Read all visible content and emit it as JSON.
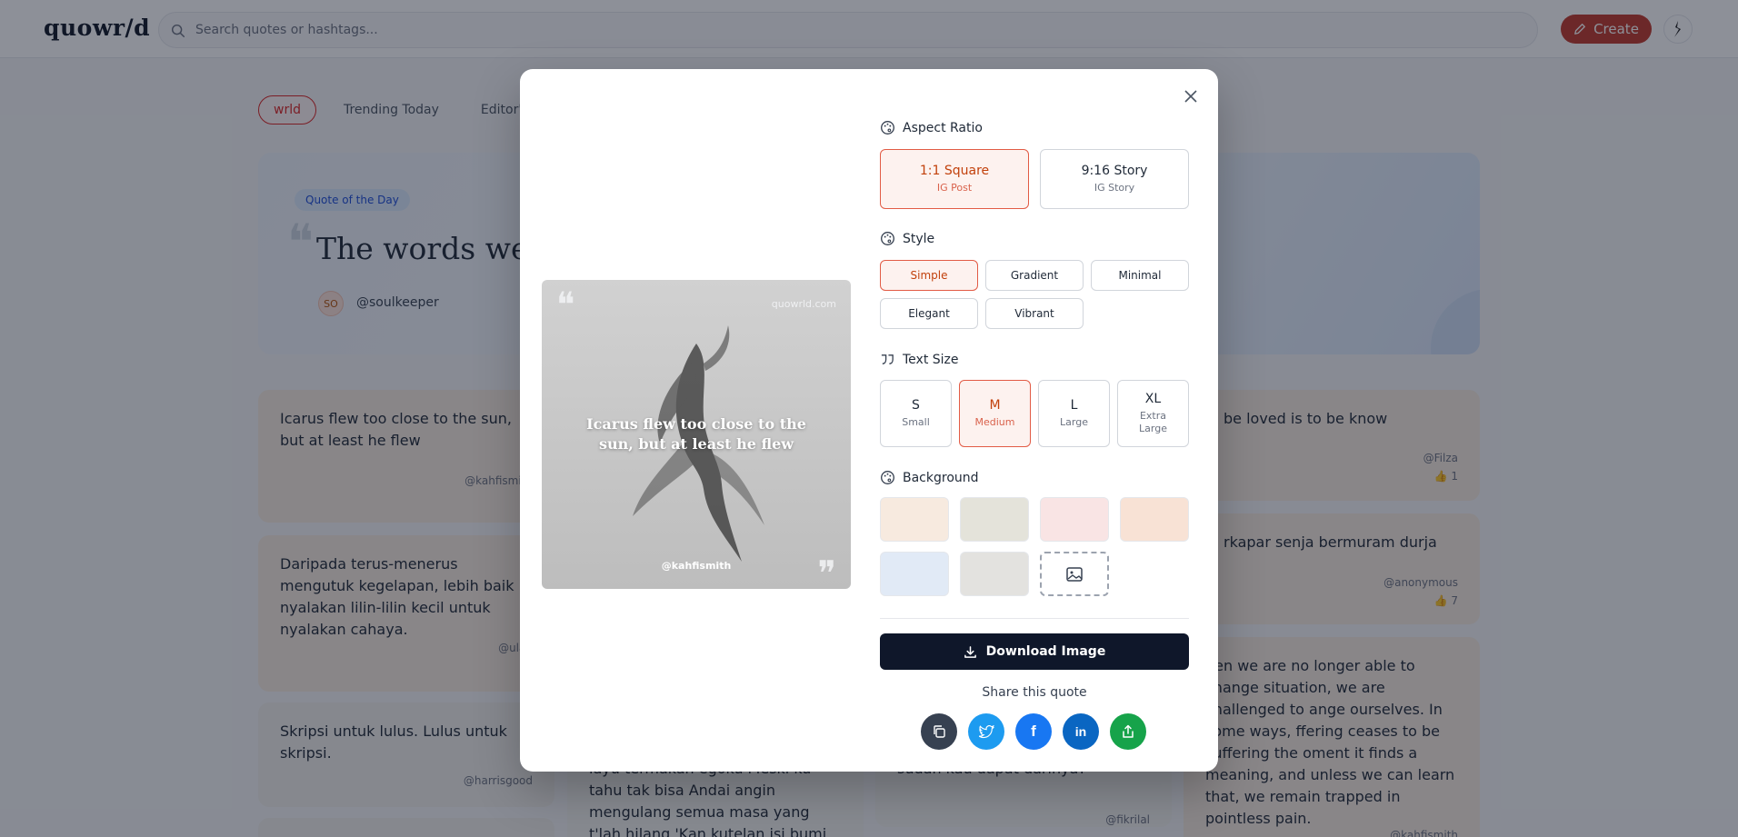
{
  "header": {
    "logo": "quowr/d",
    "search_placeholder": "Search quotes or hashtags...",
    "create_label": "Create"
  },
  "tabs": [
    {
      "label": "wrld",
      "active": true
    },
    {
      "label": "Trending Today",
      "active": false
    },
    {
      "label": "Editor's Picks",
      "active": false
    }
  ],
  "quote_of_day": {
    "badge": "Quote of the Day",
    "text": "The words we do",
    "avatar_initials": "SO",
    "user": "@soulkeeper"
  },
  "cards": [
    {
      "text": "Icarus flew too close to the sun, but at least he flew",
      "author": "@kahfismith",
      "likes": ""
    },
    {
      "text": "Daripada terus-menerus mengutuk kegelapan, lebih baik nyalakan lilin-lilin kecil untuk nyalakan cahaya.",
      "author": "@ulab",
      "likes": ""
    },
    {
      "text": "Skripsi untuk lulus. Lulus untuk skripsi.",
      "author": "@harrisgood",
      "likes": ""
    },
    {
      "text": "layu termakan egoku Meski ku tahu tak bisa Andai angin mengulang semua masa yang t'lah hilang 'Kan kutelan isi bumi hanya untukmu Terima bunga",
      "author": "",
      "likes": ""
    },
    {
      "text": "sudah kau dapat darinya?",
      "author": "@fikrilal",
      "likes": ""
    },
    {
      "text": "be loved is to be know",
      "author": "@Filza",
      "likes": "1"
    },
    {
      "text": "rkapar senja bermuram durja",
      "author": "@anonymous",
      "likes": "7"
    },
    {
      "text": "hen we are no longer able to change situation, we are challenged to ange ourselves. In some ways, ffering ceases to be suffering the oment it finds a meaning, and unless we can learn that, we remain trapped in pointless pain.",
      "author": "@kahfismith",
      "likes": ""
    }
  ],
  "modal": {
    "preview": {
      "site": "quowrld.com",
      "quote": "Icarus flew too close to the sun, but at least he flew",
      "user": "@kahfismith"
    },
    "aspect_ratio": {
      "title": "Aspect Ratio",
      "options": [
        {
          "main": "1:1 Square",
          "sub": "IG Post",
          "selected": true
        },
        {
          "main": "9:16 Story",
          "sub": "IG Story",
          "selected": false
        }
      ]
    },
    "style": {
      "title": "Style",
      "options": [
        {
          "label": "Simple",
          "selected": true
        },
        {
          "label": "Gradient",
          "selected": false
        },
        {
          "label": "Minimal",
          "selected": false
        },
        {
          "label": "Elegant",
          "selected": false
        },
        {
          "label": "Vibrant",
          "selected": false
        }
      ]
    },
    "text_size": {
      "title": "Text Size",
      "options": [
        {
          "main": "S",
          "sub": "Small",
          "selected": false
        },
        {
          "main": "M",
          "sub": "Medium",
          "selected": true
        },
        {
          "main": "L",
          "sub": "Large",
          "selected": false
        },
        {
          "main": "XL",
          "sub": "Extra Large",
          "selected": false
        }
      ]
    },
    "background": {
      "title": "Background",
      "swatches": [
        "#f7eadf",
        "#e4e3da",
        "#f9e4e4",
        "#f8e2d5",
        "#e1eaf6",
        "#e3e2df"
      ]
    },
    "download_label": "Download Image",
    "share_label": "Share this quote",
    "share_buttons": [
      {
        "name": "copy",
        "color": "#374151"
      },
      {
        "name": "twitter",
        "color": "#1d9bf0"
      },
      {
        "name": "facebook",
        "color": "#1877f2"
      },
      {
        "name": "linkedin",
        "color": "#0a66c2"
      },
      {
        "name": "share",
        "color": "#16a34a"
      }
    ]
  }
}
